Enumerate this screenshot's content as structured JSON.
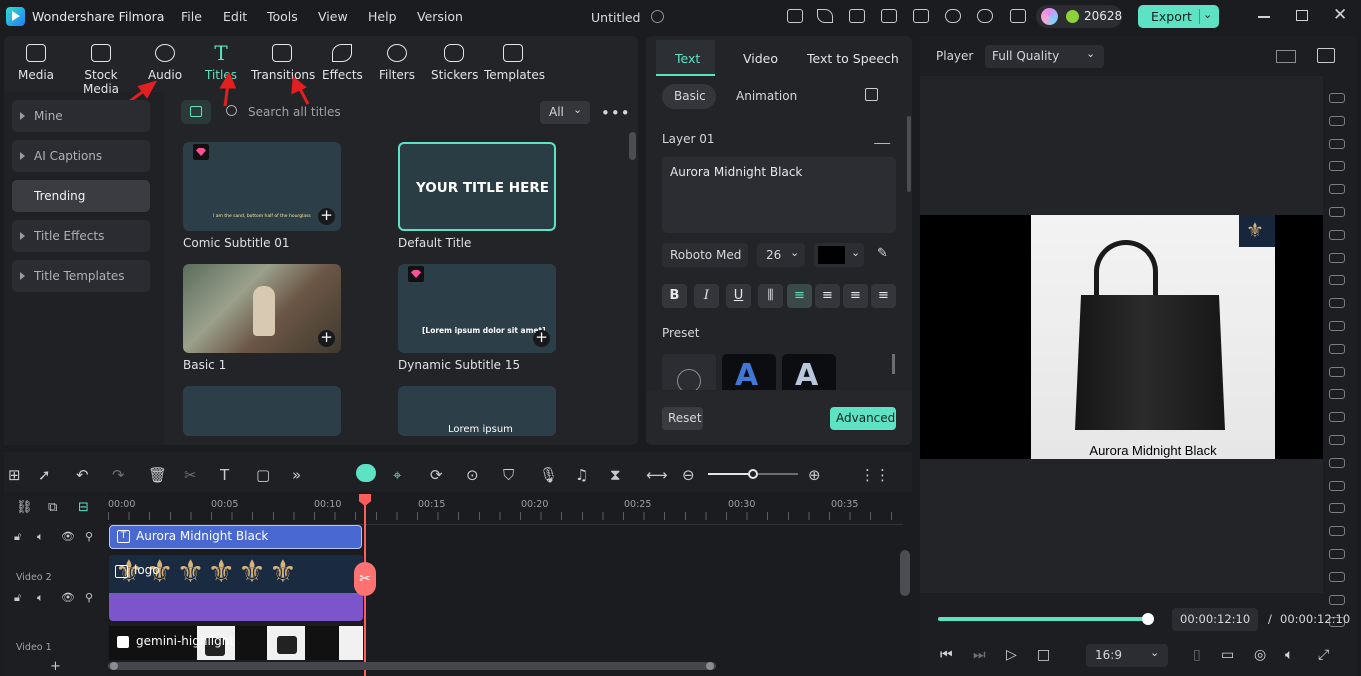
{
  "app": {
    "name": "Wondershare Filmora",
    "document_title": "Untitled",
    "credits": "20628",
    "export_label": "Export"
  },
  "menu": [
    "File",
    "Edit",
    "Tools",
    "View",
    "Help",
    "Version"
  ],
  "tool_tabs": [
    {
      "label": "Media",
      "icon": "media-icon"
    },
    {
      "label": "Stock Media",
      "icon": "stock-media-icon"
    },
    {
      "label": "Audio",
      "icon": "audio-icon"
    },
    {
      "label": "Titles",
      "icon": "titles-icon",
      "active": true
    },
    {
      "label": "Transitions",
      "icon": "transitions-icon"
    },
    {
      "label": "Effects",
      "icon": "effects-icon"
    },
    {
      "label": "Filters",
      "icon": "filters-icon"
    },
    {
      "label": "Stickers",
      "icon": "stickers-icon"
    },
    {
      "label": "Templates",
      "icon": "templates-icon"
    }
  ],
  "sidebar": [
    "Mine",
    "AI Captions",
    "Trending",
    "Title Effects",
    "Title Templates"
  ],
  "search": {
    "placeholder": "Search all titles",
    "filter": "All"
  },
  "titles": [
    {
      "name": "Comic Subtitle 01",
      "preview": "I am the sand, bottom half of the hourglass"
    },
    {
      "name": "Default Title",
      "preview": "YOUR TITLE HERE"
    },
    {
      "name": "Basic 1",
      "preview": ""
    },
    {
      "name": "Dynamic Subtitle 15",
      "preview": "[Lorem ipsum dolor sit amet]"
    },
    {
      "name": "",
      "preview": ""
    },
    {
      "name": "",
      "preview": "Lorem ipsum"
    }
  ],
  "right_panel": {
    "tabs": [
      "Text",
      "Video",
      "Text to Speech"
    ],
    "subtabs": [
      "Basic",
      "Animation"
    ],
    "layer": "Layer 01",
    "text_value": "Aurora Midnight Black",
    "font": "Roboto Med",
    "size": "26",
    "color": "#000000",
    "format_buttons": [
      "B",
      "I",
      "U"
    ],
    "preset_label": "Preset",
    "reset": "Reset",
    "advanced": "Advanced"
  },
  "player": {
    "label": "Player",
    "quality": "Full Quality",
    "caption": "Aurora Midnight Black",
    "current_time": "00:00:12:10",
    "total_time": "00:00:12:10",
    "ratio": "16:9",
    "progress": 1.0
  },
  "timeline": {
    "ruler": [
      "00:00",
      "00:05",
      "00:10",
      "00:15",
      "00:20",
      "00:25",
      "00:30",
      "00:35"
    ],
    "tracks": [
      "Video 2",
      "Video 1"
    ],
    "clips": {
      "title": "Aurora Midnight Black",
      "logo": "logo",
      "video": "gemini-highlight"
    }
  }
}
